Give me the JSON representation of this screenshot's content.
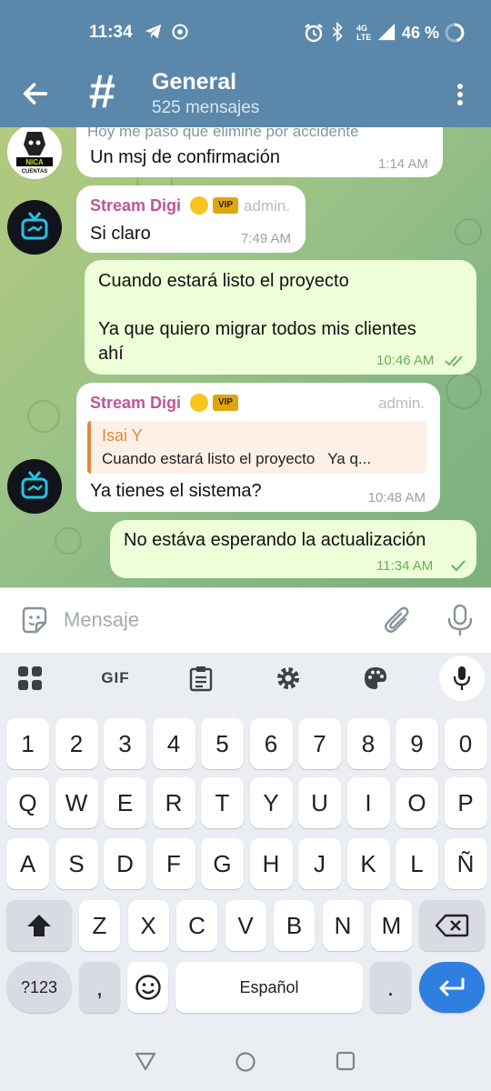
{
  "status_bar": {
    "time": "11:34",
    "network": "4G LTE",
    "battery": "46 %"
  },
  "header": {
    "title": "General",
    "subtitle": "525 mensajes"
  },
  "messages": [
    {
      "sender_avatar": "NICA CUENTAS",
      "partial_text": "Hoy me pasó que eliminé por accidente",
      "text": "Un msj de confirmación",
      "time": "1:14 AM"
    },
    {
      "sender": "Stream Digi",
      "badge": "VIP",
      "role": "admin.",
      "text": "Si claro",
      "time": "7:49 AM"
    },
    {
      "line1": "Cuando estará listo el proyecto",
      "line2": "Ya que quiero migrar todos mis clientes",
      "line3": "ahí",
      "time": "10:46 AM"
    },
    {
      "sender": "Stream Digi",
      "badge": "VIP",
      "role": "admin.",
      "reply_author": "Isai Y",
      "reply_text": "Cuando estará listo el proyecto   Ya q...",
      "text": "Ya tienes el sistema?",
      "time": "10:48 AM"
    },
    {
      "text": "No estáva esperando la actualización",
      "time": "11:34 AM"
    }
  ],
  "composer": {
    "placeholder": "Mensaje"
  },
  "keyboard": {
    "toolbar": {
      "gif": "GIF"
    },
    "row_numbers": [
      "1",
      "2",
      "3",
      "4",
      "5",
      "6",
      "7",
      "8",
      "9",
      "0"
    ],
    "row_top": [
      "Q",
      "W",
      "E",
      "R",
      "T",
      "Y",
      "U",
      "I",
      "O",
      "P"
    ],
    "row_mid": [
      "A",
      "S",
      "D",
      "F",
      "G",
      "H",
      "J",
      "K",
      "L",
      "Ñ"
    ],
    "row_bottom": [
      "Z",
      "X",
      "C",
      "V",
      "B",
      "N",
      "M"
    ],
    "symbols": "?123",
    "comma": ",",
    "space": "Español",
    "period": "."
  },
  "colors": {
    "header": "#5b87ab",
    "sender_name": "#c0549a",
    "outgoing_bubble": "#eefed9",
    "reply_accent": "#e0883a",
    "enter_key": "#2f7fe0"
  }
}
